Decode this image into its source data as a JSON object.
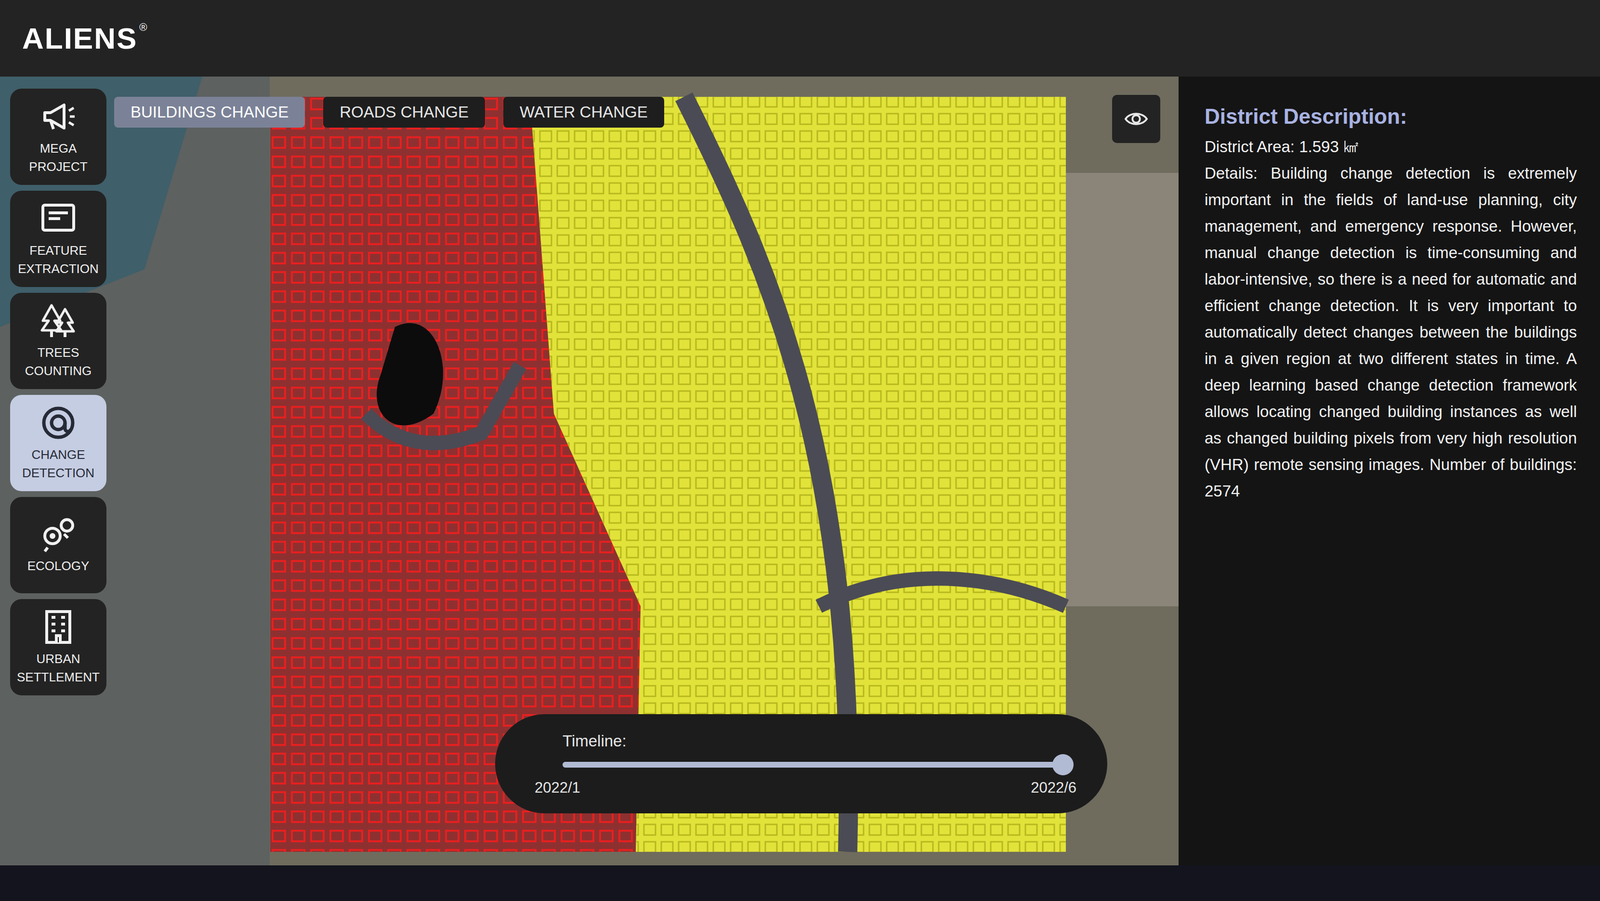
{
  "header": {
    "logo": "ALIENS",
    "trademark": "®"
  },
  "sidebar": {
    "items": [
      {
        "label": "MEGA PROJECT",
        "selected": false
      },
      {
        "label": "FEATURE EXTRACTION",
        "selected": false
      },
      {
        "label": "TREES COUNTING",
        "selected": false
      },
      {
        "label": "CHANGE DETECTION",
        "selected": true
      },
      {
        "label": "ECOLOGY",
        "selected": false
      },
      {
        "label": "URBAN SETTLEMENT",
        "selected": false
      }
    ]
  },
  "tabs": [
    {
      "label": "BUILDINGS CHANGE",
      "selected": true
    },
    {
      "label": "ROADS CHANGE",
      "selected": false
    },
    {
      "label": "WATER CHANGE",
      "selected": false
    }
  ],
  "timeline": {
    "label": "Timeline:",
    "start": "2022/1",
    "end": "2022/6",
    "level": 1
  },
  "district": {
    "title": "District Description:",
    "area": "District Area: 1.593 ㎢",
    "details": "Details: Building change detection is extremely important in the fields of land-use planning, city management, and emergency response. However, manual change detection is time-consuming and labor-intensive, so there is a need for automatic and efficient change detection. It is very important to automatically detect changes between the buildings in a given region at two different states in time. A deep learning based change detection framework allows locating changed building instances as well as changed building pixels from very high resolution (VHR) remote sensing images. Number of buildings: 2574"
  }
}
